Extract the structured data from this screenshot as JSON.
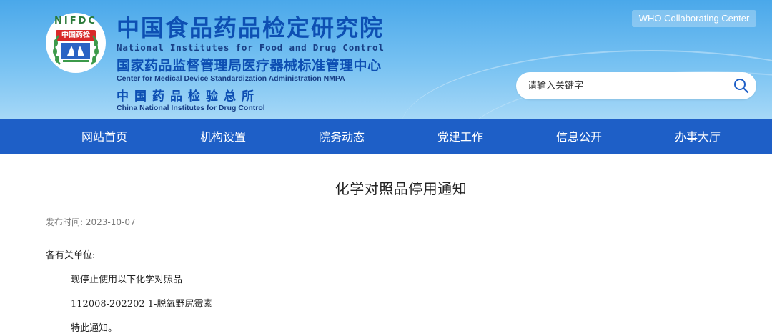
{
  "header": {
    "logo_ring_text": "NIFDC",
    "logo_badge_text": "中国药检",
    "title_cn": "中国食品药品检定研究院",
    "title_en": "National Institutes for Food and Drug Control",
    "subtitle_cn": "国家药品监督管理局医疗器械标准管理中心",
    "subtitle_en": "Center for Medical Device Standardization Administration NMPA",
    "sub2_cn": "中国药品检验总所",
    "sub2_en": "China National Institutes for Drug Control",
    "who_badge": "WHO Collaborating Center",
    "search": {
      "placeholder": "请输入关键字",
      "icon": "search-icon"
    }
  },
  "nav": {
    "items": [
      "网站首页",
      "机构设置",
      "院务动态",
      "党建工作",
      "信息公开",
      "办事大厅"
    ]
  },
  "article": {
    "title": "化学对照品停用通知",
    "publish_label": "发布时间:",
    "publish_date": "2023-10-07",
    "greeting": "各有关单位:",
    "para1": "现停止使用以下化学对照品",
    "para2": "112008-202202 1-脱氧野尻霉素",
    "para3": "特此通知。"
  },
  "colors": {
    "nav_bg": "#1e5fc7",
    "title_blue": "#0d4fb3",
    "header_gradient_top": "#4aa8ea",
    "header_gradient_bottom": "#a6d8f7"
  }
}
